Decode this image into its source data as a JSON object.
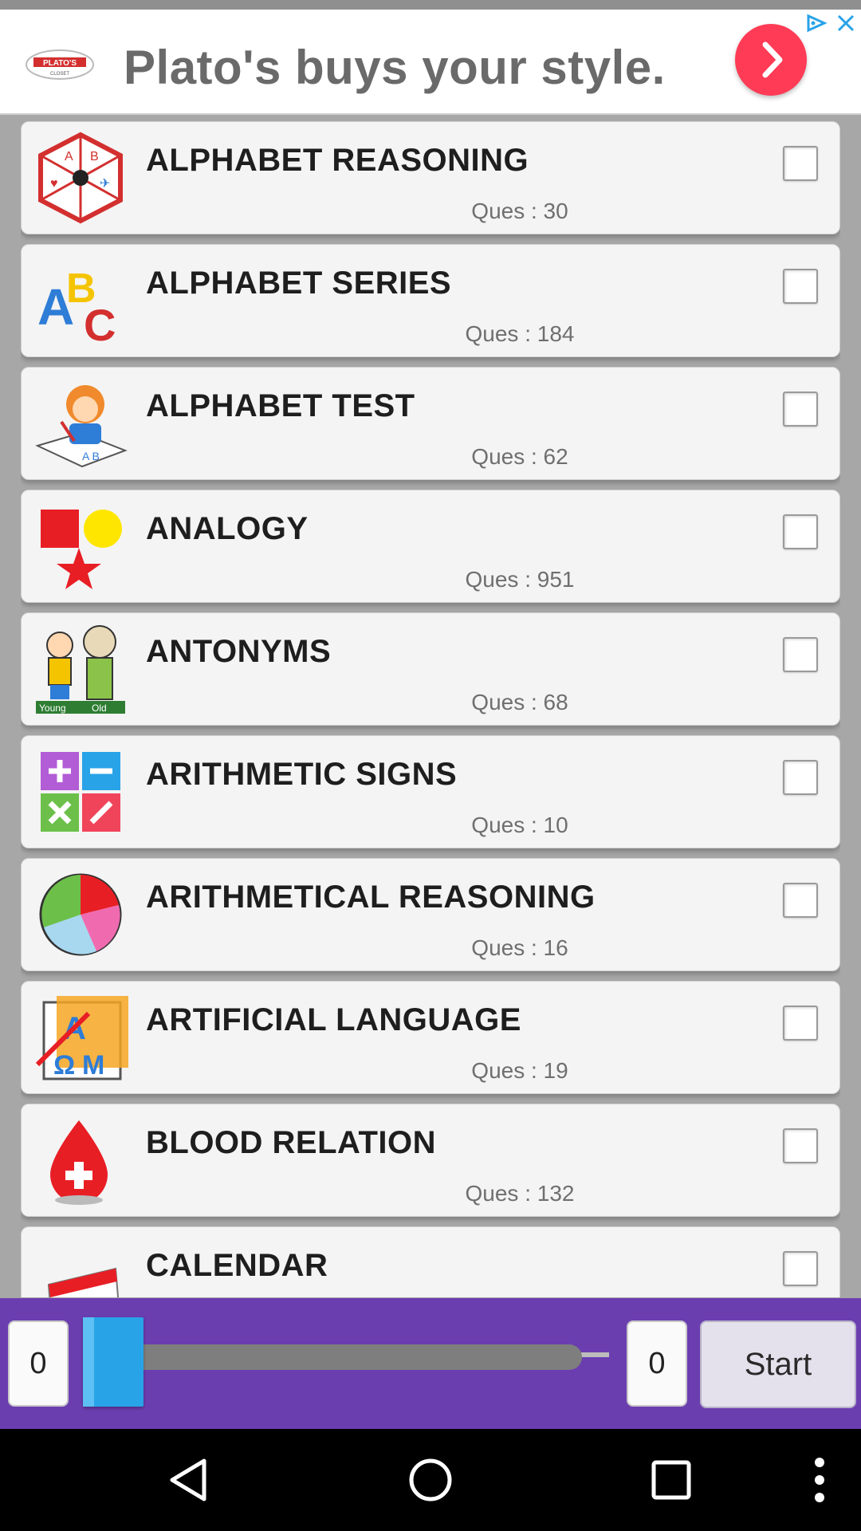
{
  "ad": {
    "text": "Plato's buys your style.",
    "logo_icon": "platos-logo-icon",
    "next_icon": "arrow-right-icon",
    "choices_icon": "ad-choices-icon",
    "close_icon": "close-icon"
  },
  "list": {
    "items": [
      {
        "title": "ALPHABET REASONING",
        "questions": "Ques : 30",
        "icon": "puzzle-alphabet-icon",
        "checked": false
      },
      {
        "title": "ALPHABET SERIES",
        "questions": "Ques : 184",
        "icon": "abc-letters-icon",
        "checked": false
      },
      {
        "title": "ALPHABET TEST",
        "questions": "Ques : 62",
        "icon": "child-writing-icon",
        "checked": false
      },
      {
        "title": "ANALOGY",
        "questions": "Ques : 951",
        "icon": "shapes-icon",
        "checked": false
      },
      {
        "title": "ANTONYMS",
        "questions": "Ques : 68",
        "icon": "young-old-icon",
        "checked": false
      },
      {
        "title": "ARITHMETIC SIGNS",
        "questions": "Ques : 10",
        "icon": "math-signs-icon",
        "checked": false
      },
      {
        "title": "ARITHMETICAL REASONING",
        "questions": "Ques : 16",
        "icon": "pie-chart-icon",
        "checked": false
      },
      {
        "title": "ARTIFICIAL LANGUAGE",
        "questions": "Ques : 19",
        "icon": "language-letters-icon",
        "checked": false
      },
      {
        "title": "BLOOD RELATION",
        "questions": "Ques : 132",
        "icon": "blood-drop-icon",
        "checked": false
      },
      {
        "title": "CALENDAR",
        "questions": "",
        "icon": "calendar-icon",
        "checked": false
      }
    ]
  },
  "controls": {
    "left_count": "0",
    "right_count": "0",
    "slider_value": 0,
    "start_label": "Start"
  },
  "navbar": {
    "back_icon": "back-triangle-icon",
    "home_icon": "home-circle-icon",
    "recents_icon": "recents-square-icon",
    "menu_icon": "more-vert-icon"
  },
  "colors": {
    "control_bar": "#6b3eb0",
    "slider_thumb": "#29a3e8",
    "ad_button": "#ff3b55"
  }
}
